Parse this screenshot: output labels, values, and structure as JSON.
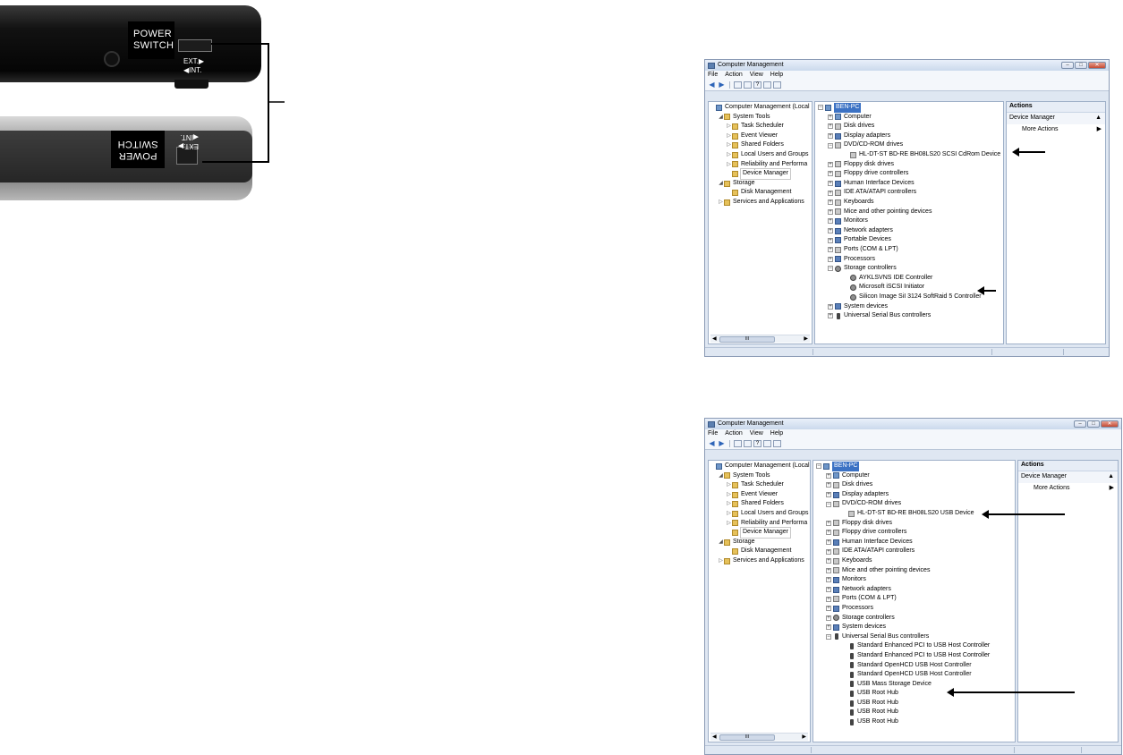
{
  "device": {
    "top_label": [
      "POWER",
      "SWITCH"
    ],
    "top_ext": "EXT.▶",
    "top_int": "◀INT.",
    "bottom_label": [
      "POWER",
      "SWITCH"
    ],
    "bottom_ext": "EXT.▶",
    "bottom_int": "◀INT."
  },
  "window1": {
    "title": "Computer Management",
    "menu": [
      "File",
      "Action",
      "View",
      "Help"
    ],
    "left_tree": [
      {
        "label": "Computer Management (Local",
        "level": 0,
        "icon": "computer-management-icon",
        "exp": ""
      },
      {
        "label": "System Tools",
        "level": 1,
        "icon": "tools-icon",
        "exp": "◢"
      },
      {
        "label": "Task Scheduler",
        "level": 2,
        "icon": "clock-icon",
        "exp": "▷"
      },
      {
        "label": "Event Viewer",
        "level": 2,
        "icon": "event-viewer-icon",
        "exp": "▷"
      },
      {
        "label": "Shared Folders",
        "level": 2,
        "icon": "shared-folders-icon",
        "exp": "▷"
      },
      {
        "label": "Local Users and Groups",
        "level": 2,
        "icon": "users-icon",
        "exp": "▷"
      },
      {
        "label": "Reliability and Performa",
        "level": 2,
        "icon": "performance-icon",
        "exp": "▷"
      },
      {
        "label": "Device Manager",
        "level": 2,
        "icon": "device-manager-icon",
        "exp": "",
        "highlight": true
      },
      {
        "label": "Storage",
        "level": 1,
        "icon": "storage-icon",
        "exp": "◢"
      },
      {
        "label": "Disk Management",
        "level": 2,
        "icon": "disk-management-icon",
        "exp": ""
      },
      {
        "label": "Services and Applications",
        "level": 1,
        "icon": "services-icon",
        "exp": "▷"
      }
    ],
    "device_tree": [
      {
        "label": "BEN-PC",
        "level": 0,
        "box": "−",
        "selected": true,
        "icon": "pc"
      },
      {
        "label": "Computer",
        "level": 1,
        "box": "+",
        "icon": "pc"
      },
      {
        "label": "Disk drives",
        "level": 1,
        "box": "+",
        "icon": "drive"
      },
      {
        "label": "Display adapters",
        "level": 1,
        "box": "+",
        "icon": "dev"
      },
      {
        "label": "DVD/CD-ROM drives",
        "level": 1,
        "box": "−",
        "icon": "drive"
      },
      {
        "label": "HL-DT-ST BD-RE  BH08LS20 SCSI CdRom Device",
        "level": 2,
        "box": "",
        "icon": "drive"
      },
      {
        "label": "Floppy disk drives",
        "level": 1,
        "box": "+",
        "icon": "drive"
      },
      {
        "label": "Floppy drive controllers",
        "level": 1,
        "box": "+",
        "icon": "drive"
      },
      {
        "label": "Human Interface Devices",
        "level": 1,
        "box": "+",
        "icon": "dev"
      },
      {
        "label": "IDE ATA/ATAPI controllers",
        "level": 1,
        "box": "+",
        "icon": "drive"
      },
      {
        "label": "Keyboards",
        "level": 1,
        "box": "+",
        "icon": "drive"
      },
      {
        "label": "Mice and other pointing devices",
        "level": 1,
        "box": "+",
        "icon": "drive"
      },
      {
        "label": "Monitors",
        "level": 1,
        "box": "+",
        "icon": "dev"
      },
      {
        "label": "Network adapters",
        "level": 1,
        "box": "+",
        "icon": "dev"
      },
      {
        "label": "Portable Devices",
        "level": 1,
        "box": "+",
        "icon": "dev"
      },
      {
        "label": "Ports (COM & LPT)",
        "level": 1,
        "box": "+",
        "icon": "drive"
      },
      {
        "label": "Processors",
        "level": 1,
        "box": "+",
        "icon": "dev"
      },
      {
        "label": "Storage controllers",
        "level": 1,
        "box": "−",
        "icon": "gear"
      },
      {
        "label": "AYKLSVNS IDE Controller",
        "level": 2,
        "box": "",
        "icon": "gear"
      },
      {
        "label": "Microsoft iSCSI Initiator",
        "level": 2,
        "box": "",
        "icon": "gear"
      },
      {
        "label": "Silicon Image SiI 3124 SoftRaid 5 Controller",
        "level": 2,
        "box": "",
        "icon": "gear"
      },
      {
        "label": "System devices",
        "level": 1,
        "box": "+",
        "icon": "dev"
      },
      {
        "label": "Universal Serial Bus controllers",
        "level": 1,
        "box": "+",
        "icon": "usb"
      }
    ],
    "actions_title": "Actions",
    "actions_section": "Device Manager",
    "actions_more": "More Actions",
    "scroll_thumb": "III"
  },
  "window2": {
    "title": "Computer Management",
    "menu": [
      "File",
      "Action",
      "View",
      "Help"
    ],
    "left_tree": [
      {
        "label": "Computer Management (Local",
        "level": 0,
        "icon": "computer-management-icon",
        "exp": ""
      },
      {
        "label": "System Tools",
        "level": 1,
        "icon": "tools-icon",
        "exp": "◢"
      },
      {
        "label": "Task Scheduler",
        "level": 2,
        "icon": "clock-icon",
        "exp": "▷"
      },
      {
        "label": "Event Viewer",
        "level": 2,
        "icon": "event-viewer-icon",
        "exp": "▷"
      },
      {
        "label": "Shared Folders",
        "level": 2,
        "icon": "shared-folders-icon",
        "exp": "▷"
      },
      {
        "label": "Local Users and Groups",
        "level": 2,
        "icon": "users-icon",
        "exp": "▷"
      },
      {
        "label": "Reliability and Performa",
        "level": 2,
        "icon": "performance-icon",
        "exp": "▷"
      },
      {
        "label": "Device Manager",
        "level": 2,
        "icon": "device-manager-icon",
        "exp": "",
        "highlight": true
      },
      {
        "label": "Storage",
        "level": 1,
        "icon": "storage-icon",
        "exp": "◢"
      },
      {
        "label": "Disk Management",
        "level": 2,
        "icon": "disk-management-icon",
        "exp": ""
      },
      {
        "label": "Services and Applications",
        "level": 1,
        "icon": "services-icon",
        "exp": "▷"
      }
    ],
    "device_tree": [
      {
        "label": "BEN-PC",
        "level": 0,
        "box": "−",
        "selected": true,
        "icon": "pc"
      },
      {
        "label": "Computer",
        "level": 1,
        "box": "+",
        "icon": "pc"
      },
      {
        "label": "Disk drives",
        "level": 1,
        "box": "+",
        "icon": "drive"
      },
      {
        "label": "Display adapters",
        "level": 1,
        "box": "+",
        "icon": "dev"
      },
      {
        "label": "DVD/CD-ROM drives",
        "level": 1,
        "box": "−",
        "icon": "drive"
      },
      {
        "label": "HL-DT-ST BD-RE  BH08LS20 USB Device",
        "level": 2,
        "box": "",
        "icon": "drive"
      },
      {
        "label": "Floppy disk drives",
        "level": 1,
        "box": "+",
        "icon": "drive"
      },
      {
        "label": "Floppy drive controllers",
        "level": 1,
        "box": "+",
        "icon": "drive"
      },
      {
        "label": "Human Interface Devices",
        "level": 1,
        "box": "+",
        "icon": "dev"
      },
      {
        "label": "IDE ATA/ATAPI controllers",
        "level": 1,
        "box": "+",
        "icon": "drive"
      },
      {
        "label": "Keyboards",
        "level": 1,
        "box": "+",
        "icon": "drive"
      },
      {
        "label": "Mice and other pointing devices",
        "level": 1,
        "box": "+",
        "icon": "drive"
      },
      {
        "label": "Monitors",
        "level": 1,
        "box": "+",
        "icon": "dev"
      },
      {
        "label": "Network adapters",
        "level": 1,
        "box": "+",
        "icon": "dev"
      },
      {
        "label": "Ports (COM & LPT)",
        "level": 1,
        "box": "+",
        "icon": "drive"
      },
      {
        "label": "Processors",
        "level": 1,
        "box": "+",
        "icon": "dev"
      },
      {
        "label": "Storage controllers",
        "level": 1,
        "box": "+",
        "icon": "gear"
      },
      {
        "label": "System devices",
        "level": 1,
        "box": "+",
        "icon": "dev"
      },
      {
        "label": "Universal Serial Bus controllers",
        "level": 1,
        "box": "−",
        "icon": "usb"
      },
      {
        "label": "Standard Enhanced PCI to USB Host Controller",
        "level": 2,
        "box": "",
        "icon": "usb"
      },
      {
        "label": "Standard Enhanced PCI to USB Host Controller",
        "level": 2,
        "box": "",
        "icon": "usb"
      },
      {
        "label": "Standard OpenHCD USB Host Controller",
        "level": 2,
        "box": "",
        "icon": "usb"
      },
      {
        "label": "Standard OpenHCD USB Host Controller",
        "level": 2,
        "box": "",
        "icon": "usb"
      },
      {
        "label": "USB Mass Storage Device",
        "level": 2,
        "box": "",
        "icon": "usb"
      },
      {
        "label": "USB Root Hub",
        "level": 2,
        "box": "",
        "icon": "usb"
      },
      {
        "label": "USB Root Hub",
        "level": 2,
        "box": "",
        "icon": "usb"
      },
      {
        "label": "USB Root Hub",
        "level": 2,
        "box": "",
        "icon": "usb"
      },
      {
        "label": "USB Root Hub",
        "level": 2,
        "box": "",
        "icon": "usb"
      }
    ],
    "actions_title": "Actions",
    "actions_section": "Device Manager",
    "actions_more": "More Actions",
    "scroll_thumb": "III"
  }
}
